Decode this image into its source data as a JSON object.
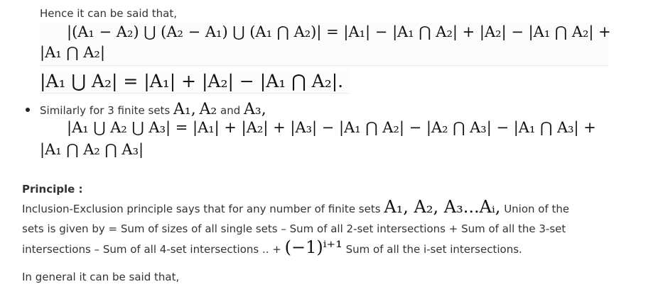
{
  "intro_line": "Hence it can be said that,",
  "eq1_line1": "|(A₁ − A₂) ⋃ (A₂ − A₁) ⋃ (A₁ ⋂ A₂)| = |A₁| − |A₁ ⋂ A₂| + |A₂| − |A₁ ⋂ A₂| +",
  "eq1_line2": "|A₁ ⋂ A₂|",
  "eq2": "|A₁ ⋃ A₂| = |A₁| + |A₂| − |A₁ ⋂ A₂|.",
  "bullet": {
    "text_before": "Similarly for 3 finite sets",
    "set1": "A₁,",
    "set2": "A₂",
    "and_word": "and",
    "set3": "A₃,"
  },
  "eq3_line1": "|A₁ ⋃ A₂ ⋃ A₃| = |A₁| + |A₂| + |A₃| − |A₁ ⋂ A₂| − |A₂ ⋂ A₃| − |A₁ ⋂ A₃| +",
  "eq3_line2": "|A₁ ⋂ A₂ ⋂ A₃|",
  "principle_heading": "Principle :",
  "principle": {
    "line1_text": "Inclusion-Exclusion principle says that for any number of finite sets",
    "line1_math": "A₁, A₂, A₃...Aᵢ,",
    "line1_tail": "Union of the",
    "line2": "sets is given by = Sum of sizes of all single sets – Sum of all 2-set intersections + Sum of all the 3-set",
    "line3_text": "intersections – Sum of all 4-set intersections .. +",
    "line3_math": "(−1)ⁱ⁺¹",
    "line3_tail": "Sum of all the i-set intersections."
  },
  "general_line": "In general it can be said that,"
}
